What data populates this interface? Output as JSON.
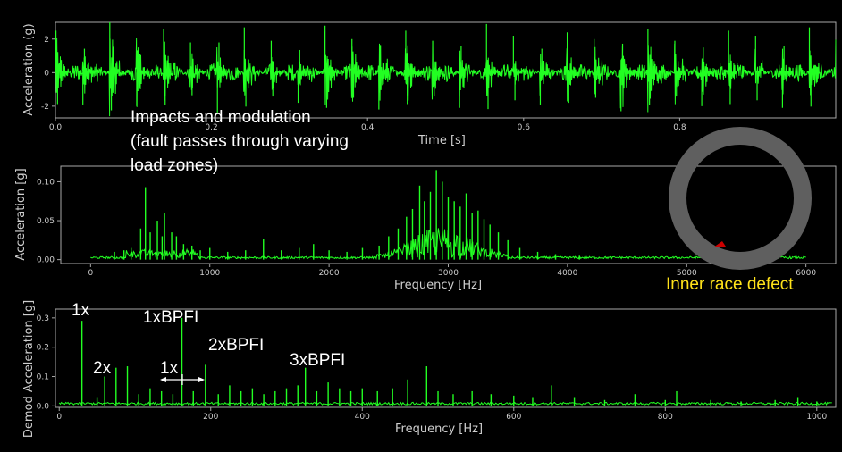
{
  "colors": {
    "signal": "#22ff22",
    "background": "#000000",
    "axes": "#a8a8a8",
    "text": "#cfcfcf",
    "annotation": "#ffffff",
    "defect_label": "#ffe21a",
    "ring": "#5f5f5f",
    "defect_mark": "#cc0000"
  },
  "chart_data": [
    {
      "type": "line",
      "title": "",
      "xlabel": "Time [s]",
      "ylabel": "Acceleration (g)",
      "xlim": [
        0.0,
        1.0
      ],
      "ylim": [
        -2.7,
        3.0
      ],
      "xticks": [
        "0.0",
        "0.2",
        "0.4",
        "0.6",
        "0.8"
      ],
      "yticks": [
        "2",
        "0",
        "-2"
      ],
      "grid": false,
      "impact_count": 29,
      "impact_peaks": [
        2.5,
        -1.9,
        3.0,
        -2.0,
        2.6,
        1.8,
        -2.4,
        2.7,
        1.9,
        -1.8,
        2.8,
        2.0,
        -2.2,
        2.5,
        1.9,
        -2.1,
        2.9,
        2.2,
        -1.9,
        2.4,
        2.0,
        -2.3,
        2.6,
        1.9,
        -2.0,
        2.5,
        2.2,
        -2.1,
        2.7
      ],
      "noise_amplitude": 0.55
    },
    {
      "type": "line",
      "title": "",
      "xlabel": "Frequency [Hz]",
      "ylabel": "Acceleration [g]",
      "xlim": [
        -250,
        6250
      ],
      "ylim": [
        -0.005,
        0.12
      ],
      "xticks": [
        "0",
        "1000",
        "2000",
        "3000",
        "4000",
        "5000",
        "6000"
      ],
      "yticks": [
        "0.10",
        "0.05",
        "0.00"
      ],
      "grid": false,
      "peaks": [
        {
          "x": 200,
          "y": 0.01
        },
        {
          "x": 280,
          "y": 0.012
        },
        {
          "x": 340,
          "y": 0.015
        },
        {
          "x": 420,
          "y": 0.04
        },
        {
          "x": 460,
          "y": 0.093
        },
        {
          "x": 500,
          "y": 0.035
        },
        {
          "x": 560,
          "y": 0.05
        },
        {
          "x": 600,
          "y": 0.03
        },
        {
          "x": 620,
          "y": 0.06
        },
        {
          "x": 680,
          "y": 0.035
        },
        {
          "x": 720,
          "y": 0.03
        },
        {
          "x": 780,
          "y": 0.02
        },
        {
          "x": 850,
          "y": 0.018
        },
        {
          "x": 920,
          "y": 0.012
        },
        {
          "x": 1000,
          "y": 0.015
        },
        {
          "x": 1150,
          "y": 0.01
        },
        {
          "x": 1300,
          "y": 0.012
        },
        {
          "x": 1450,
          "y": 0.027
        },
        {
          "x": 1600,
          "y": 0.012
        },
        {
          "x": 1750,
          "y": 0.015
        },
        {
          "x": 1870,
          "y": 0.02
        },
        {
          "x": 2000,
          "y": 0.012
        },
        {
          "x": 2150,
          "y": 0.01
        },
        {
          "x": 2280,
          "y": 0.015
        },
        {
          "x": 2420,
          "y": 0.018
        },
        {
          "x": 2500,
          "y": 0.03
        },
        {
          "x": 2580,
          "y": 0.04
        },
        {
          "x": 2650,
          "y": 0.055
        },
        {
          "x": 2700,
          "y": 0.065
        },
        {
          "x": 2760,
          "y": 0.095
        },
        {
          "x": 2800,
          "y": 0.075
        },
        {
          "x": 2850,
          "y": 0.087
        },
        {
          "x": 2900,
          "y": 0.115
        },
        {
          "x": 2950,
          "y": 0.1
        },
        {
          "x": 3000,
          "y": 0.08
        },
        {
          "x": 3050,
          "y": 0.075
        },
        {
          "x": 3100,
          "y": 0.068
        },
        {
          "x": 3150,
          "y": 0.085
        },
        {
          "x": 3200,
          "y": 0.06
        },
        {
          "x": 3250,
          "y": 0.063
        },
        {
          "x": 3300,
          "y": 0.052
        },
        {
          "x": 3350,
          "y": 0.045
        },
        {
          "x": 3420,
          "y": 0.035
        },
        {
          "x": 3500,
          "y": 0.025
        },
        {
          "x": 3600,
          "y": 0.015
        },
        {
          "x": 3750,
          "y": 0.01
        },
        {
          "x": 3900,
          "y": 0.007
        },
        {
          "x": 4100,
          "y": 0.005
        },
        {
          "x": 5450,
          "y": 0.005
        }
      ],
      "noise_floor": 0.004
    },
    {
      "type": "line",
      "title": "",
      "xlabel": "Frequency [Hz]",
      "ylabel": "Demod Acceleration [g]",
      "xlim": [
        -5,
        1025
      ],
      "ylim": [
        -0.005,
        0.33
      ],
      "xticks": [
        "0",
        "200",
        "400",
        "600",
        "800",
        "1000"
      ],
      "yticks": [
        "0.3",
        "0.2",
        "0.1",
        "0.0"
      ],
      "grid": false,
      "peaks": [
        {
          "x": 30,
          "y": 0.29
        },
        {
          "x": 50,
          "y": 0.03
        },
        {
          "x": 60,
          "y": 0.1
        },
        {
          "x": 75,
          "y": 0.13
        },
        {
          "x": 90,
          "y": 0.135
        },
        {
          "x": 105,
          "y": 0.04
        },
        {
          "x": 120,
          "y": 0.06
        },
        {
          "x": 135,
          "y": 0.05
        },
        {
          "x": 150,
          "y": 0.04
        },
        {
          "x": 162,
          "y": 0.3
        },
        {
          "x": 177,
          "y": 0.05
        },
        {
          "x": 193,
          "y": 0.14
        },
        {
          "x": 210,
          "y": 0.04
        },
        {
          "x": 225,
          "y": 0.07
        },
        {
          "x": 240,
          "y": 0.05
        },
        {
          "x": 255,
          "y": 0.06
        },
        {
          "x": 270,
          "y": 0.04
        },
        {
          "x": 285,
          "y": 0.05
        },
        {
          "x": 300,
          "y": 0.06
        },
        {
          "x": 315,
          "y": 0.07
        },
        {
          "x": 325,
          "y": 0.13
        },
        {
          "x": 340,
          "y": 0.05
        },
        {
          "x": 355,
          "y": 0.08
        },
        {
          "x": 370,
          "y": 0.06
        },
        {
          "x": 385,
          "y": 0.05
        },
        {
          "x": 400,
          "y": 0.06
        },
        {
          "x": 420,
          "y": 0.05
        },
        {
          "x": 440,
          "y": 0.06
        },
        {
          "x": 460,
          "y": 0.09
        },
        {
          "x": 485,
          "y": 0.135
        },
        {
          "x": 500,
          "y": 0.05
        },
        {
          "x": 520,
          "y": 0.04
        },
        {
          "x": 545,
          "y": 0.05
        },
        {
          "x": 570,
          "y": 0.04
        },
        {
          "x": 600,
          "y": 0.035
        },
        {
          "x": 625,
          "y": 0.03
        },
        {
          "x": 650,
          "y": 0.07
        },
        {
          "x": 680,
          "y": 0.03
        },
        {
          "x": 720,
          "y": 0.02
        },
        {
          "x": 760,
          "y": 0.04
        },
        {
          "x": 800,
          "y": 0.02
        },
        {
          "x": 815,
          "y": 0.05
        },
        {
          "x": 860,
          "y": 0.02
        },
        {
          "x": 900,
          "y": 0.015
        },
        {
          "x": 945,
          "y": 0.02
        },
        {
          "x": 975,
          "y": 0.03
        },
        {
          "x": 1000,
          "y": 0.015
        }
      ],
      "noise_floor": 0.012
    }
  ],
  "annotations": {
    "impacts_line1": "Impacts and modulation",
    "impacts_line2": "(fault passes through varying",
    "impacts_line3": "load zones)",
    "inner_race": "Inner race defect",
    "label_1x_top": "1x",
    "label_1xbpfi": "1xBPFI",
    "label_2x": "2x",
    "label_2xbpfi": "2xBPFI",
    "label_3xbpfi": "3xBPFI",
    "label_1x_interval": "1x"
  }
}
